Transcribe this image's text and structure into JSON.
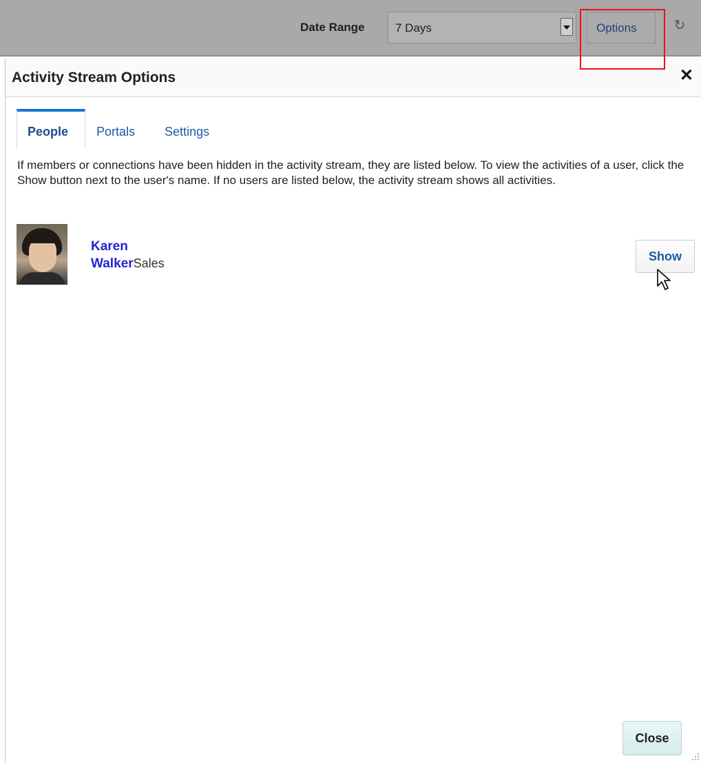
{
  "toolbar": {
    "date_range_label": "Date Range",
    "date_range_value": "7 Days",
    "options_label": "Options",
    "refresh_icon": "refresh-icon"
  },
  "dialog": {
    "title": "Activity Stream Options",
    "close_icon": "close-icon",
    "tabs": [
      {
        "label": "People",
        "active": true
      },
      {
        "label": "Portals",
        "active": false
      },
      {
        "label": "Settings",
        "active": false
      }
    ],
    "description": "If members or connections have been hidden in the activity stream, they are listed below. To view the activities of a user, click the Show button next to the user's name. If no users are listed below, the activity stream shows all activities.",
    "hidden_users": [
      {
        "first_name": "Karen",
        "last_name": "Walker",
        "department": "Sales",
        "action_label": "Show"
      }
    ],
    "close_button_label": "Close"
  },
  "colors": {
    "accent": "#1877c9",
    "link": "#1a5aa6",
    "name_link": "#2323d6",
    "highlight_box": "#ee1111"
  }
}
